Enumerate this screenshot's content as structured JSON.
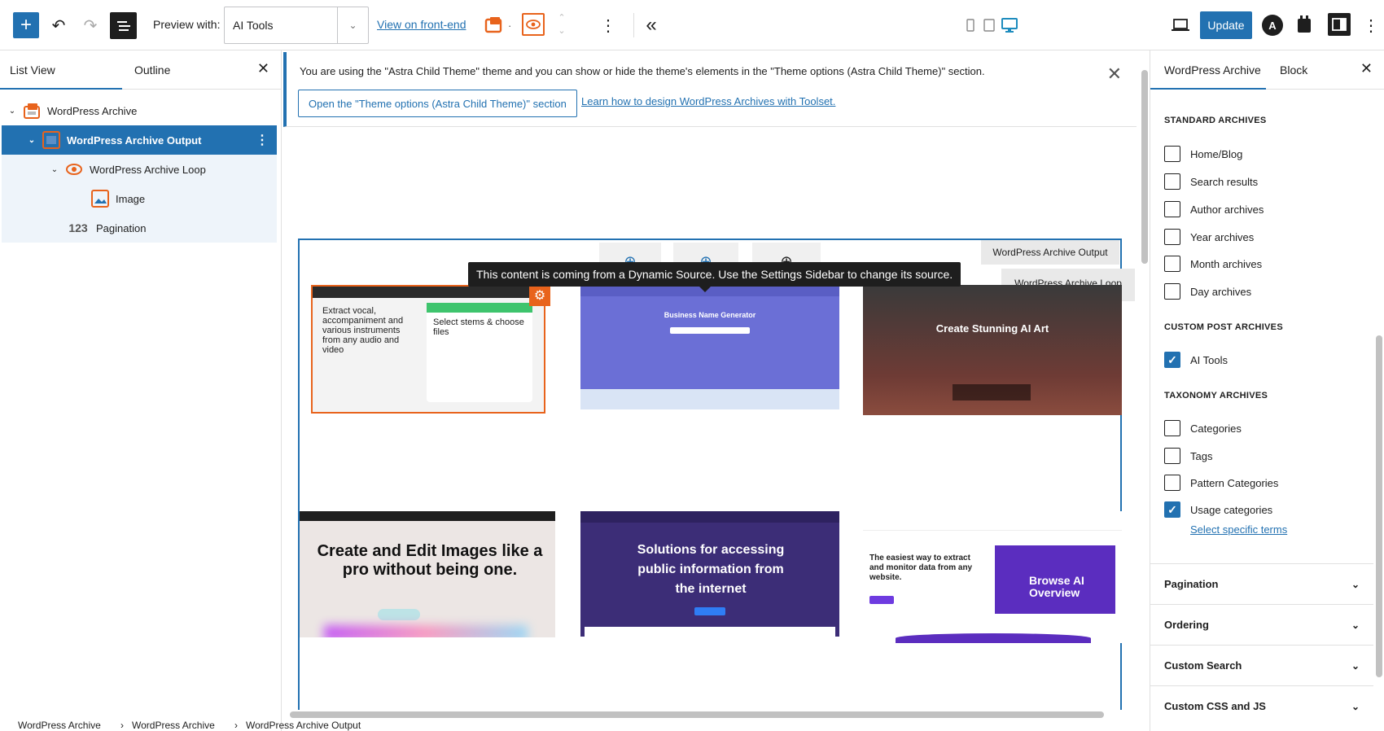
{
  "toolbar": {
    "preview_label": "Preview with:",
    "preview_value": "AI Tools",
    "view_link": "View on front-end",
    "update_label": "Update"
  },
  "left_panel": {
    "tabs": [
      "List View",
      "Outline"
    ],
    "tree": [
      {
        "label": "WordPress Archive"
      },
      {
        "label": "WordPress Archive Output"
      },
      {
        "label": "WordPress Archive Loop"
      },
      {
        "label": "Image"
      },
      {
        "label": "Pagination",
        "icon_text": "123"
      }
    ]
  },
  "notice": {
    "text": "You are using the \"Astra Child Theme\" theme and you can show or hide the theme's elements in the \"Theme options (Astra Child Theme)\" section.",
    "button": "Open the \"Theme options (Astra Child Theme)\" section",
    "link": "Learn how to design WordPress Archives with Toolset."
  },
  "canvas": {
    "chip_output": "WordPress Archive Output",
    "chip_loop": "WordPress Archive Loop",
    "tooltip": "This content is coming from a Dynamic Source. Use the Settings Sidebar to change its source.",
    "thumbs": {
      "t1_left": "Extract vocal, accompaniment and various instruments from any audio and video",
      "t1_right": "Select stems & choose files",
      "t2": "Business Name Generator",
      "t3": "Create Stunning AI Art",
      "t4": "Create and Edit Images like a pro without being one.",
      "t5": "Solutions for accessing public information from the internet",
      "t6_head": "The easiest way to extract and monitor data from any website.",
      "t6_card": "Browse AI Overview"
    }
  },
  "right_panel": {
    "tabs": [
      "WordPress Archive",
      "Block"
    ],
    "standard_head": "STANDARD ARCHIVES",
    "standard": [
      {
        "label": "Home/Blog",
        "checked": false
      },
      {
        "label": "Search results",
        "checked": false
      },
      {
        "label": "Author archives",
        "checked": false
      },
      {
        "label": "Year archives",
        "checked": false
      },
      {
        "label": "Month archives",
        "checked": false
      },
      {
        "label": "Day archives",
        "checked": false
      }
    ],
    "custom_head": "CUSTOM POST ARCHIVES",
    "custom": [
      {
        "label": "AI Tools",
        "checked": true
      }
    ],
    "taxonomy_head": "TAXONOMY ARCHIVES",
    "taxonomy": [
      {
        "label": "Categories",
        "checked": false
      },
      {
        "label": "Tags",
        "checked": false
      },
      {
        "label": "Pattern Categories",
        "checked": false
      },
      {
        "label": "Usage categories",
        "checked": true
      }
    ],
    "select_terms": "Select specific terms",
    "accordions": [
      "Pagination",
      "Ordering",
      "Custom Search",
      "Custom CSS and JS"
    ]
  },
  "breadcrumb": [
    "WordPress Archive",
    "WordPress Archive",
    "WordPress Archive Output"
  ],
  "colors": {
    "accent": "#2271b1",
    "orange": "#e8631c"
  }
}
